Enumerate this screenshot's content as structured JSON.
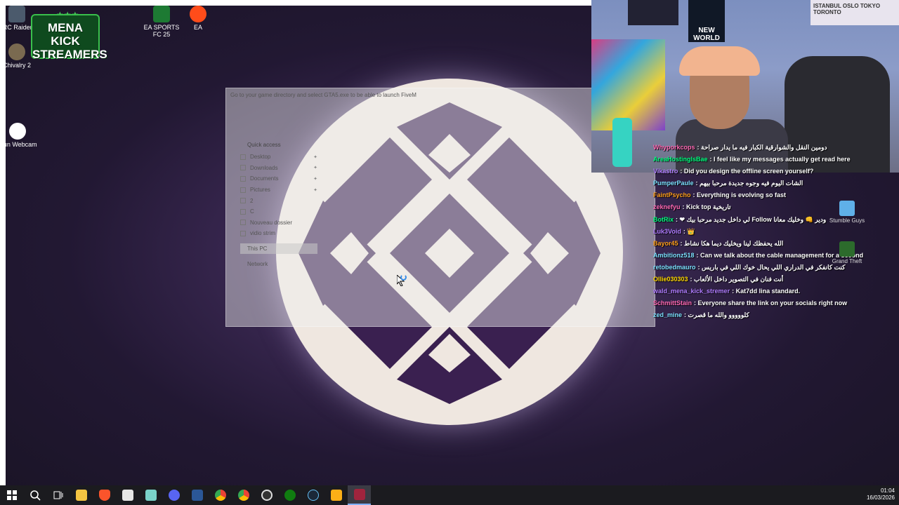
{
  "desktop": {
    "icons": [
      {
        "label": "ARC Raiders"
      },
      {
        "label": "Chivalry 2"
      },
      {
        "label": "Iriun Webcam"
      },
      {
        "label": "EA SPORTS FC 25"
      },
      {
        "label": "EA"
      }
    ],
    "overlay_logo": {
      "text": "MENA KICK STREAMERS",
      "stars": "★★★"
    }
  },
  "file_dialog": {
    "title": "Go to your game directory and select GTA5.exe to be able to launch FiveM",
    "quick_access": "Quick access",
    "nav_items": [
      {
        "label": "Desktop",
        "pinned": true
      },
      {
        "label": "Downloads",
        "pinned": true
      },
      {
        "label": "Documents",
        "pinned": true
      },
      {
        "label": "Pictures",
        "pinned": true
      },
      {
        "label": "2",
        "pinned": false
      },
      {
        "label": "C",
        "pinned": false
      },
      {
        "label": "Nouveau dossier",
        "pinned": false
      },
      {
        "label": "vidio strim",
        "pinned": false
      }
    ],
    "this_pc": "This PC",
    "network": "Network"
  },
  "webcam": {
    "poster_text": "NEW WORLD",
    "banner_text": "ISTANBUL OSLO TOKYO TORONTO"
  },
  "chat": {
    "messages": [
      {
        "user": "Whyporkcops",
        "color": "#ff69b4",
        "text": "دومين النقل والشوارقية الكبار فيه ما يدار صراحة"
      },
      {
        "user": "AreaHostingIsBae",
        "color": "#00ff7f",
        "text": "I feel like my messages actually get read here"
      },
      {
        "user": "Vikastro",
        "color": "#b07cff",
        "text": "Did you design the offline screen yourself?"
      },
      {
        "user": "PumperPaule",
        "color": "#7ce0ff",
        "text": "الشات اليوم فيه وجوه جديدة مرحبا بيهم"
      },
      {
        "user": "FaintPsycho",
        "color": "#ff9f1c",
        "text": "Everything is evolving so fast"
      },
      {
        "user": "zeknefyu",
        "color": "#ff69b4",
        "text": "Kick top تاريخية"
      },
      {
        "user": "BotRix",
        "color": "#00ff7f",
        "text": "❤ لي داخل جديد مرحبا بيك Follow ودير 👊 وخليك معانا"
      },
      {
        "user": "Luk3Void",
        "color": "#b07cff",
        "text": "👑"
      },
      {
        "user": "Bayor45",
        "color": "#ff9f1c",
        "text": "الله يحفظك لينا ويخليك ديما هكا نشاط"
      },
      {
        "user": "Ambitionz518",
        "color": "#7ce0ff",
        "text": "Can we talk about the cable management for a second"
      },
      {
        "user": "retobedmauro",
        "color": "#7ce0ff",
        "text": "كنت كانفكر في الدراري اللي يحال خوك اللي في باريس"
      },
      {
        "user": "Ollie030303",
        "color": "#ffd700",
        "text": "أنت فنان في التصوير داخل الألعاب"
      },
      {
        "user": "wald_mena_kick_stremer",
        "color": "#b07cff",
        "text": "Kat7dd lina standard."
      },
      {
        "user": "SchmittStain",
        "color": "#ff69b4",
        "text": "Everyone share the link on your socials right now"
      },
      {
        "user": "zed_mine",
        "color": "#7ce0ff",
        "text": "كلووووو والله ما قصرت"
      }
    ]
  },
  "side_icons": [
    {
      "label": "Stumble Guys"
    },
    {
      "label": "Grand Theft"
    }
  ],
  "taskbar": {
    "apps": [
      "start-icon",
      "search-icon",
      "task-view-icon",
      "file-explorer-icon",
      "brave-icon",
      "calculator-icon",
      "notepad-icon",
      "discord-icon",
      "word-icon",
      "chrome-icon",
      "chrome-alt-icon",
      "obs-icon",
      "xbox-icon",
      "steam-icon",
      "rockstar-icon",
      "arc-icon"
    ],
    "time": "01:04",
    "date": "16/03/2026"
  },
  "colors": {
    "accent": "#6a4b8e",
    "logo_fill": "#efe7e0",
    "logo_dark": "#3a2050"
  }
}
